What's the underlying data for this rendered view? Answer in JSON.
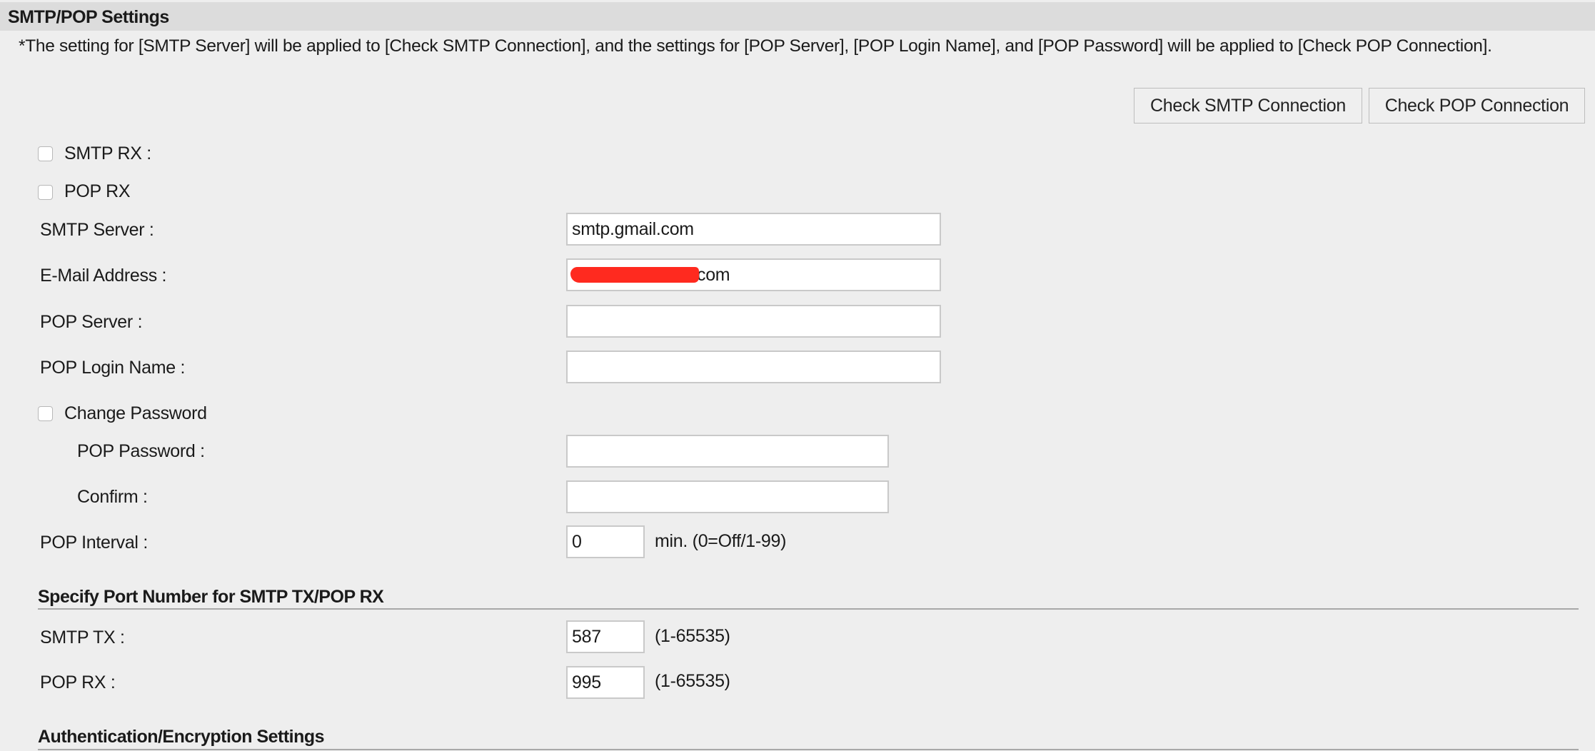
{
  "section_title": "SMTP/POP Settings",
  "note": "*The setting for [SMTP Server] will be applied to [Check SMTP Connection], and the settings for [POP Server], [POP Login Name], and [POP Password] will be applied to [Check POP Connection].",
  "buttons": {
    "check_smtp": "Check SMTP Connection",
    "check_pop": "Check POP Connection"
  },
  "checkboxes": {
    "smtp_rx": {
      "label": "SMTP RX :",
      "checked": false
    },
    "pop_rx": {
      "label": "POP RX",
      "checked": false
    },
    "change_password": {
      "label": "Change Password",
      "checked": false
    }
  },
  "fields": {
    "smtp_server": {
      "label": "SMTP Server :",
      "value": "smtp.gmail.com"
    },
    "email": {
      "label": "E-Mail Address :",
      "value": "com"
    },
    "pop_server": {
      "label": "POP Server :",
      "value": ""
    },
    "pop_login": {
      "label": "POP Login Name :",
      "value": ""
    },
    "pop_password": {
      "label": "POP Password :",
      "value": ""
    },
    "confirm": {
      "label": "Confirm :",
      "value": ""
    },
    "pop_interval": {
      "label": "POP Interval :",
      "value": "0",
      "hint": "min. (0=Off/1-99)"
    }
  },
  "ports": {
    "title": "Specify Port Number for SMTP TX/POP RX",
    "smtp_tx": {
      "label": "SMTP TX :",
      "value": "587",
      "hint": "(1-65535)"
    },
    "pop_rx": {
      "label": "POP RX :",
      "value": "995",
      "hint": "(1-65535)"
    }
  },
  "auth_section_title": "Authentication/Encryption Settings",
  "colors": {
    "redaction": "#ff2a1f",
    "header_bg": "#dcdcdc",
    "page_bg": "#eeeeee"
  }
}
